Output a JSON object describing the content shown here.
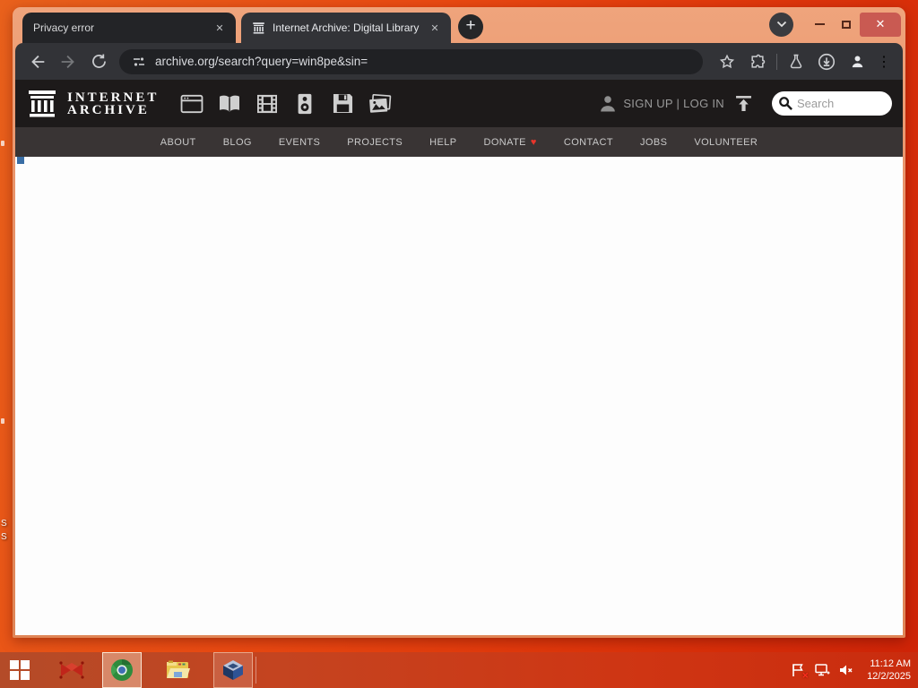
{
  "browser": {
    "tabs": [
      {
        "title": "Privacy error"
      },
      {
        "title": "Internet Archive: Digital Library"
      }
    ],
    "address_bar": {
      "url": "archive.org/search?query=win8pe&sin="
    }
  },
  "archive": {
    "logo_line1": "INTERNET",
    "logo_line2": "ARCHIVE",
    "auth": "SIGN UP | LOG IN",
    "search_placeholder": "Search",
    "media_types": [
      "web",
      "texts",
      "video",
      "audio",
      "software",
      "images"
    ],
    "nav_items": [
      {
        "label": "ABOUT"
      },
      {
        "label": "BLOG"
      },
      {
        "label": "EVENTS"
      },
      {
        "label": "PROJECTS"
      },
      {
        "label": "HELP"
      },
      {
        "label": "DONATE"
      },
      {
        "label": "CONTACT"
      },
      {
        "label": "JOBS"
      },
      {
        "label": "VOLUNTEER"
      }
    ]
  },
  "taskbar": {
    "time": "11:12 AM",
    "date": "12/2/2025"
  },
  "desktop": {
    "icon_label_fragments": [
      "S",
      "S"
    ]
  },
  "icons": {
    "close_glyph": "✕",
    "new_tab_glyph": "+",
    "heart_glyph": "♥",
    "kebab_glyph": "⋮"
  },
  "colors": {
    "titlebar": "#e8936a",
    "toolbar": "#323337",
    "address_pill": "#202124",
    "archive_header": "#1d1a1a",
    "archive_nav": "#393434",
    "content": "#fdfdfd",
    "desktop_red": "#e8430f",
    "taskbar_red": "#c44420",
    "close_button": "#c95a52",
    "donate_heart": "#e8352b"
  }
}
